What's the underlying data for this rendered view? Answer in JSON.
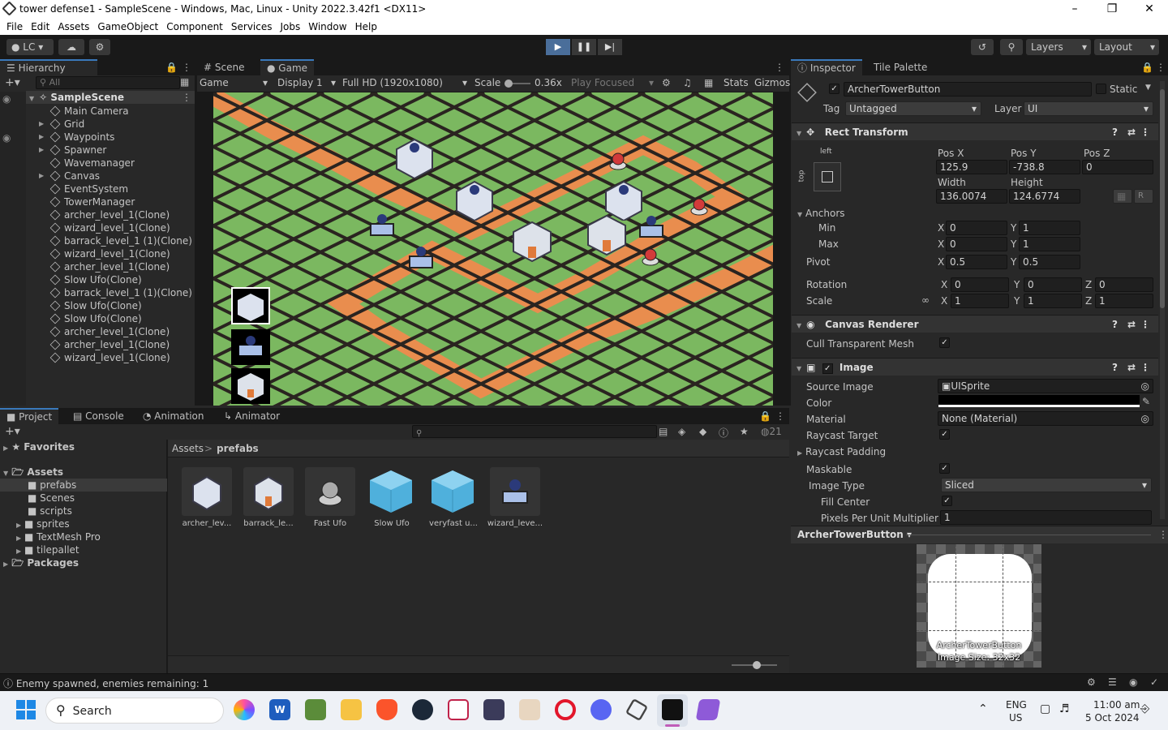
{
  "window": {
    "title": "tower defense1 - SampleScene - Windows, Mac, Linux - Unity 2022.3.42f1 <DX11>"
  },
  "menu": [
    "File",
    "Edit",
    "Assets",
    "GameObject",
    "Component",
    "Services",
    "Jobs",
    "Window",
    "Help"
  ],
  "toolbar": {
    "account": "LC",
    "layers": "Layers",
    "layout": "Layout"
  },
  "hierarchy": {
    "tab": "Hierarchy",
    "search_placeholder": "All",
    "scene": "SampleScene",
    "items": [
      "Main Camera",
      "Grid",
      "Waypoints",
      "Spawner",
      "Wavemanager",
      "Canvas",
      "EventSystem",
      "TowerManager",
      "archer_level_1(Clone)",
      "wizard_level_1(Clone)",
      "barrack_level_1 (1)(Clone)",
      "wizard_level_1(Clone)",
      "archer_level_1(Clone)",
      "Slow Ufo(Clone)",
      "barrack_level_1 (1)(Clone)",
      "Slow Ufo(Clone)",
      "Slow Ufo(Clone)",
      "archer_level_1(Clone)",
      "archer_level_1(Clone)",
      "wizard_level_1(Clone)"
    ]
  },
  "view": {
    "tabs": [
      "Scene",
      "Game"
    ],
    "mode": "Game",
    "display": "Display 1",
    "resolution": "Full HD (1920x1080)",
    "scale_label": "Scale",
    "scale_value": "0.36x",
    "play_focused": "Play Focused",
    "stats": "Stats",
    "gizmos": "Gizmos"
  },
  "inspector": {
    "tabs": [
      "Inspector",
      "Tile Palette"
    ],
    "object_name": "ArcherTowerButton",
    "static": "Static",
    "tag_label": "Tag",
    "tag": "Untagged",
    "layer_label": "Layer",
    "layer": "UI",
    "rect": {
      "title": "Rect Transform",
      "anchor_h": "left",
      "anchor_v": "top",
      "posx_label": "Pos X",
      "posy_label": "Pos Y",
      "posz_label": "Pos Z",
      "posx": "125.9",
      "posy": "-738.8",
      "posz": "0",
      "width_label": "Width",
      "height_label": "Height",
      "width": "136.0074",
      "height": "124.6774",
      "r": "R",
      "anchors": "Anchors",
      "min": "Min",
      "max": "Max",
      "min_x": "0",
      "min_y": "1",
      "max_x": "0",
      "max_y": "1",
      "pivot": "Pivot",
      "pivot_x": "0.5",
      "pivot_y": "0.5",
      "rotation": "Rotation",
      "rot_x": "0",
      "rot_y": "0",
      "rot_z": "0",
      "scale": "Scale",
      "scale_x": "1",
      "scale_y": "1",
      "scale_z": "1",
      "x": "X",
      "y": "Y",
      "z": "Z"
    },
    "canvas_renderer": {
      "title": "Canvas Renderer",
      "cull": "Cull Transparent Mesh"
    },
    "image": {
      "title": "Image",
      "source_label": "Source Image",
      "source": "UISprite",
      "color_label": "Color",
      "material_label": "Material",
      "material": "None (Material)",
      "raycast_target": "Raycast Target",
      "raycast_padding": "Raycast Padding",
      "maskable": "Maskable",
      "image_type_label": "Image Type",
      "image_type": "Sliced",
      "fill_center": "Fill Center",
      "ppu_label": "Pixels Per Unit Multiplier",
      "ppu": "1"
    },
    "preview": {
      "title": "ArcherTowerButton",
      "caption1": "ArcherTowerButton",
      "caption2": "Image Size: 32x32"
    }
  },
  "project": {
    "tabs": [
      "Project",
      "Console",
      "Animation",
      "Animator"
    ],
    "count": "21",
    "favorites": "Favorites",
    "assets": "Assets",
    "folders": [
      "prefabs",
      "Scenes",
      "scripts",
      "sprites",
      "TextMesh Pro",
      "tilepallet"
    ],
    "packages": "Packages",
    "breadcrumb": [
      "Assets",
      "prefabs"
    ],
    "items": [
      "archer_lev...",
      "barrack_le...",
      "Fast Ufo",
      "Slow Ufo",
      "veryfast u...",
      "wizard_leve..."
    ]
  },
  "status": "Enemy spawned, enemies remaining: 1",
  "taskbar": {
    "search": "Search",
    "lang1": "ENG",
    "lang2": "US",
    "time": "11:00 am",
    "date": "5 Oct 2024"
  },
  "colors": {
    "accent": "#3a79bb",
    "grass": "#7bb860",
    "path": "#e98d4e"
  }
}
